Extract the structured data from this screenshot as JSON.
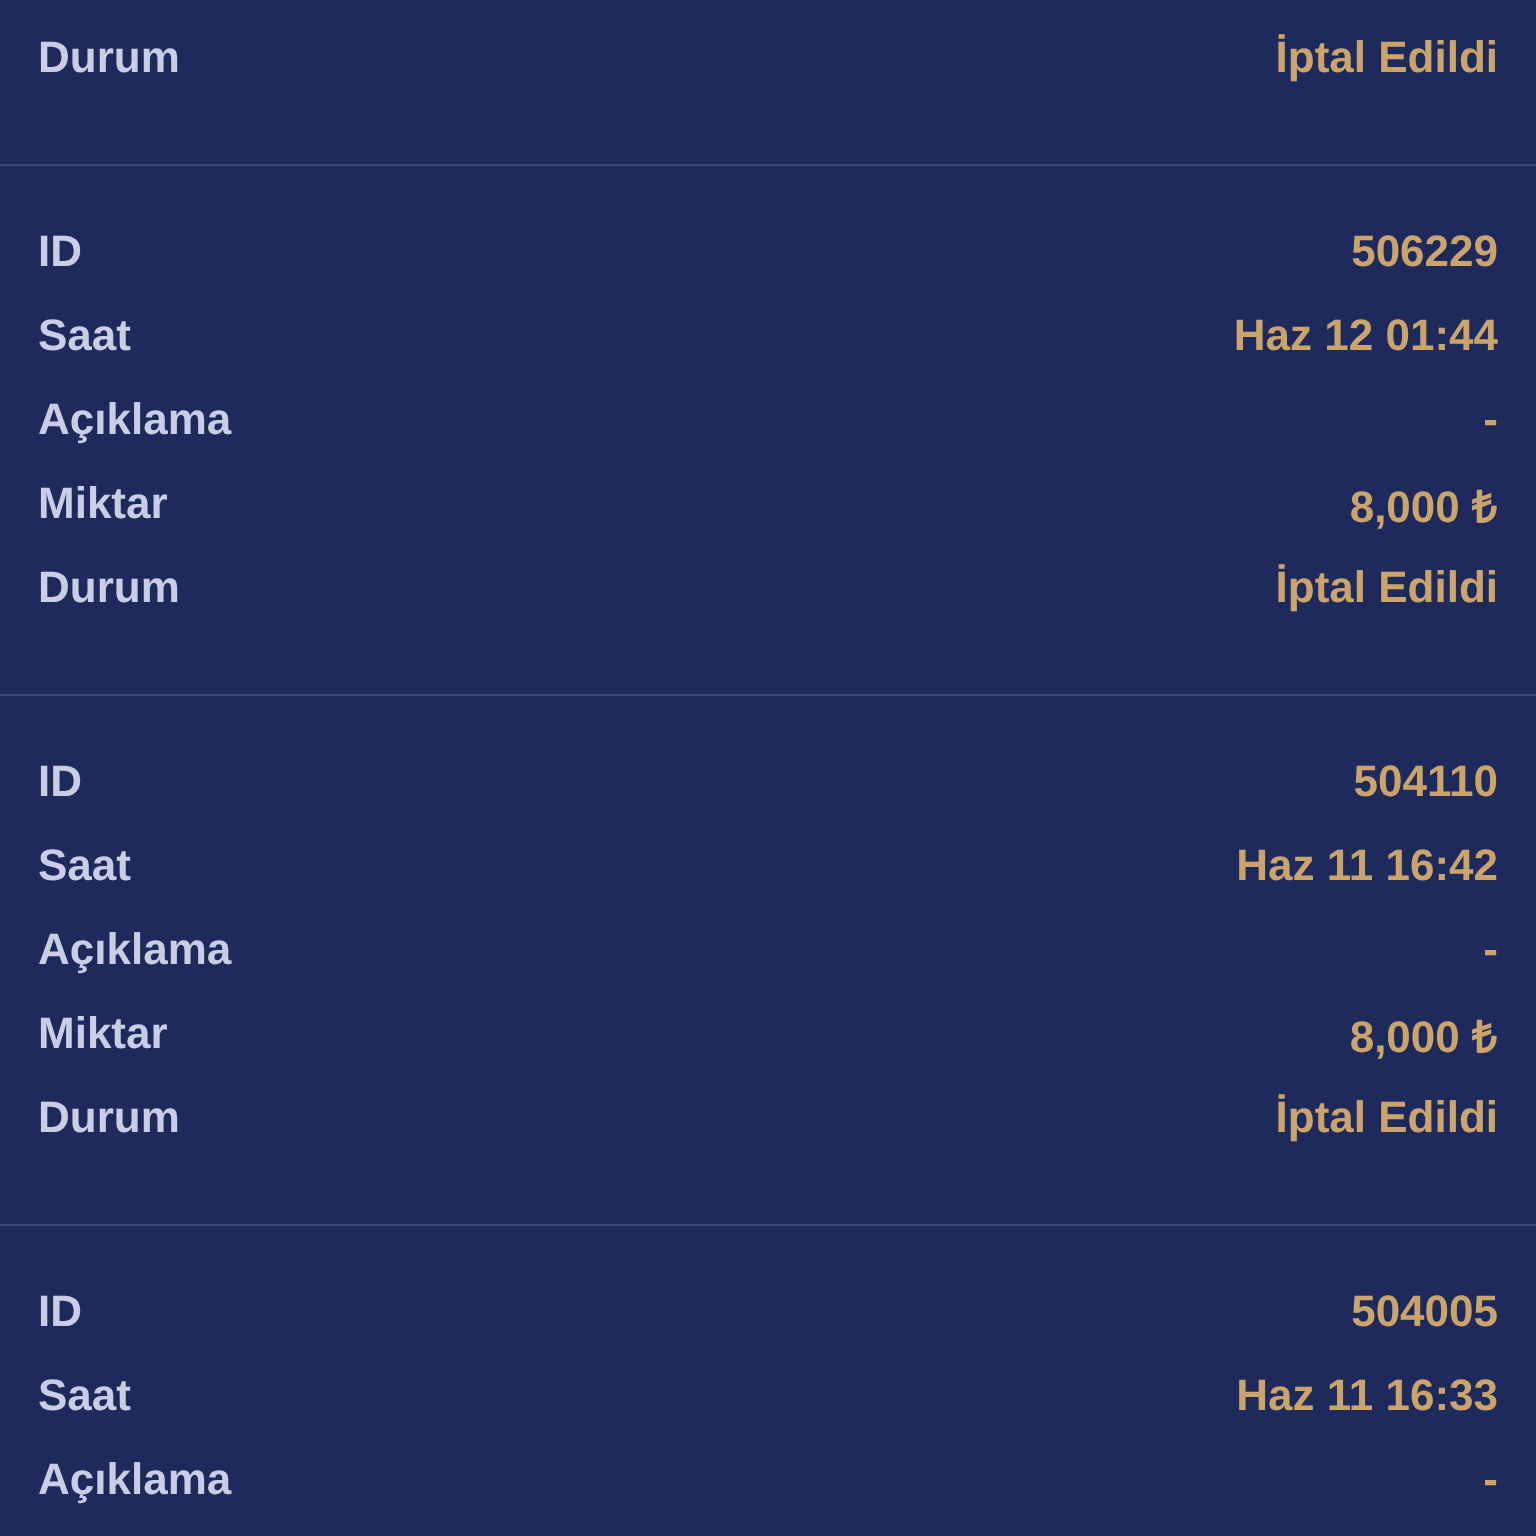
{
  "transactions": [
    {
      "fields": [
        {
          "label": "Durum",
          "value": "İptal Edildi"
        }
      ]
    },
    {
      "fields": [
        {
          "label": "ID",
          "value": "506229"
        },
        {
          "label": "Saat",
          "value": "Haz 12 01:44"
        },
        {
          "label": "Açıklama",
          "value": "-"
        },
        {
          "label": "Miktar",
          "value": "8,000 ₺"
        },
        {
          "label": "Durum",
          "value": "İptal Edildi"
        }
      ]
    },
    {
      "fields": [
        {
          "label": "ID",
          "value": "504110"
        },
        {
          "label": "Saat",
          "value": "Haz 11 16:42"
        },
        {
          "label": "Açıklama",
          "value": "-"
        },
        {
          "label": "Miktar",
          "value": "8,000 ₺"
        },
        {
          "label": "Durum",
          "value": "İptal Edildi"
        }
      ]
    },
    {
      "fields": [
        {
          "label": "ID",
          "value": "504005"
        },
        {
          "label": "Saat",
          "value": "Haz 11 16:33"
        },
        {
          "label": "Açıklama",
          "value": "-"
        }
      ]
    }
  ]
}
